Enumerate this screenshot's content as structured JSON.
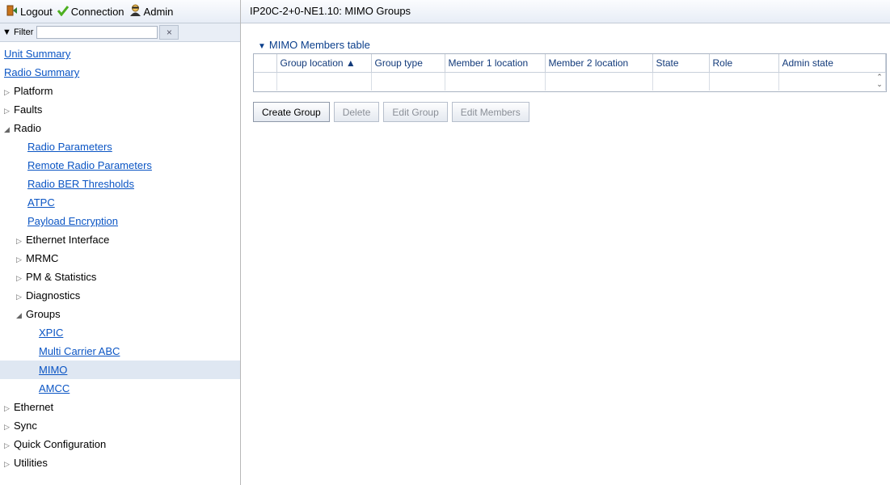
{
  "topbar": {
    "logout": "Logout",
    "connection": "Connection",
    "admin": "Admin"
  },
  "filter": {
    "label": "Filter",
    "value": "",
    "clear": "×"
  },
  "tree": [
    {
      "label": "Unit Summary",
      "type": "link0"
    },
    {
      "label": "Radio Summary",
      "type": "link0"
    },
    {
      "label": "Platform",
      "type": "collapsed",
      "level": 0
    },
    {
      "label": "Faults",
      "type": "collapsed",
      "level": 0
    },
    {
      "label": "Radio",
      "type": "expanded",
      "level": 0
    },
    {
      "label": "Radio Parameters",
      "type": "link1"
    },
    {
      "label": "Remote Radio Parameters",
      "type": "link1"
    },
    {
      "label": "Radio BER Thresholds",
      "type": "link1"
    },
    {
      "label": "ATPC",
      "type": "link1"
    },
    {
      "label": "Payload Encryption",
      "type": "link1"
    },
    {
      "label": "Ethernet Interface",
      "type": "collapsed",
      "level": 1
    },
    {
      "label": "MRMC",
      "type": "collapsed",
      "level": 1
    },
    {
      "label": "PM & Statistics",
      "type": "collapsed",
      "level": 1
    },
    {
      "label": "Diagnostics",
      "type": "collapsed",
      "level": 1
    },
    {
      "label": "Groups",
      "type": "expanded",
      "level": 1
    },
    {
      "label": "XPIC",
      "type": "link2"
    },
    {
      "label": "Multi Carrier ABC",
      "type": "link2"
    },
    {
      "label": "MIMO",
      "type": "link2",
      "selected": true
    },
    {
      "label": "AMCC",
      "type": "link2"
    },
    {
      "label": "Ethernet",
      "type": "collapsed",
      "level": 0
    },
    {
      "label": "Sync",
      "type": "collapsed",
      "level": 0
    },
    {
      "label": "Quick Configuration",
      "type": "collapsed",
      "level": 0
    },
    {
      "label": "Utilities",
      "type": "collapsed",
      "level": 0
    }
  ],
  "page": {
    "title": "IP20C-2+0-NE1.10: MIMO Groups",
    "section_title": "MIMO Members table"
  },
  "table": {
    "columns": [
      "Group location ▲",
      "Group type",
      "Member 1 location",
      "Member 2 location",
      "State",
      "Role",
      "Admin state"
    ],
    "rows": []
  },
  "buttons": [
    {
      "label": "Create Group",
      "enabled": true,
      "name": "create-group-button"
    },
    {
      "label": "Delete",
      "enabled": false,
      "name": "delete-button"
    },
    {
      "label": "Edit Group",
      "enabled": false,
      "name": "edit-group-button"
    },
    {
      "label": "Edit Members",
      "enabled": false,
      "name": "edit-members-button"
    }
  ],
  "icons": {
    "logout": "logout-icon",
    "connection": "checkmark-icon",
    "admin": "admin-user-icon"
  }
}
